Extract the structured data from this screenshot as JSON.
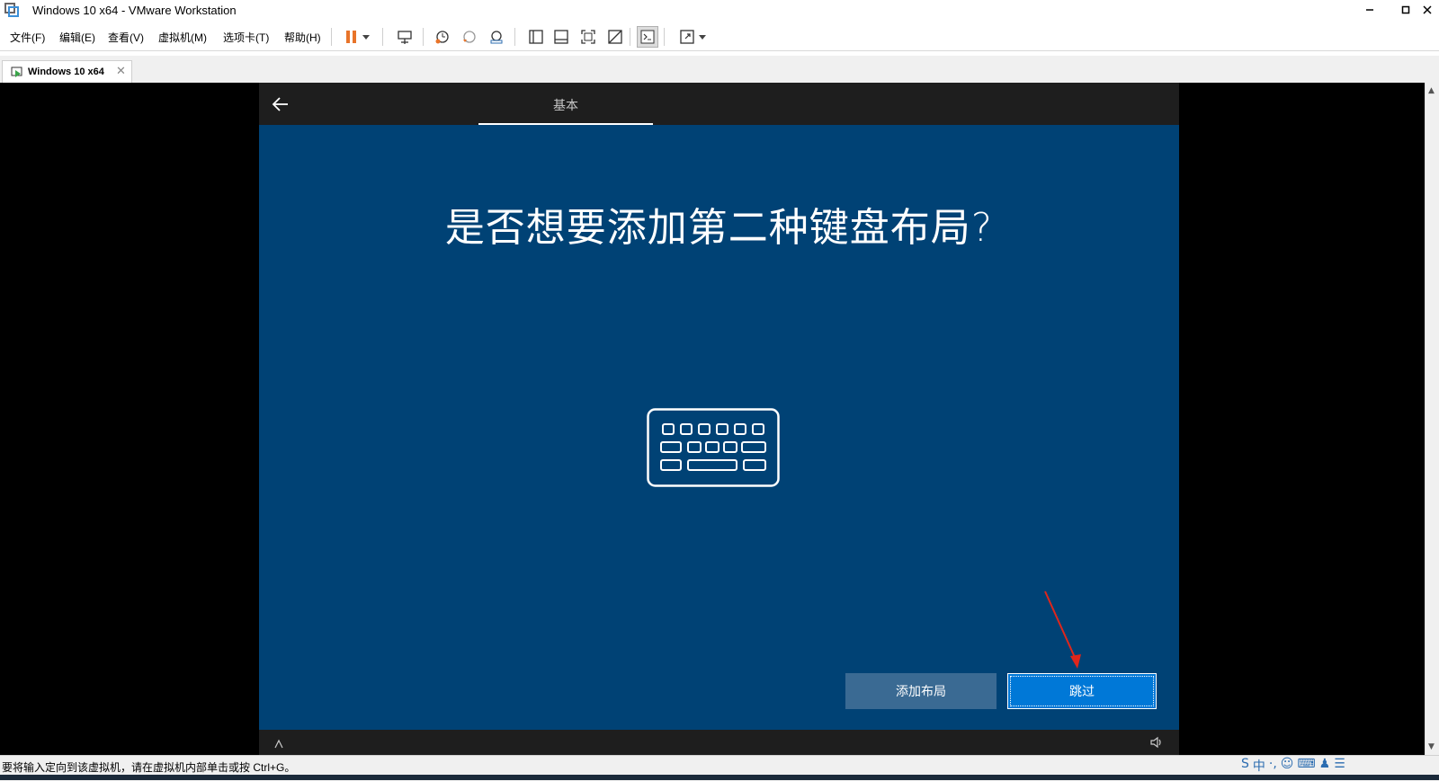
{
  "window": {
    "title": "Windows 10 x64 - VMware Workstation"
  },
  "menu": {
    "items": [
      "文件(F)",
      "编辑(E)",
      "查看(V)",
      "虚拟机(M)",
      "选项卡(T)",
      "帮助(H)"
    ]
  },
  "toolbar": {
    "icons": [
      "pause-icon",
      "dropdown-icon",
      "send-ctrl-alt-del-icon",
      "snapshot-icon",
      "revert-snapshot-icon",
      "snapshot-manager-icon",
      "show-library-icon",
      "thumbnail-bar-icon",
      "full-screen-icon",
      "unity-icon",
      "console-view-icon",
      "stretch-icon",
      "dropdown-icon"
    ]
  },
  "tabs": {
    "vm_tab_label": "Windows 10 x64"
  },
  "oobe": {
    "header_tab": "基本",
    "title": "是否想要添加第二种键盘布局?",
    "add_layout_button": "添加布局",
    "skip_button": "跳过",
    "bg_color": "#004275",
    "accent_color": "#0078d7"
  },
  "status": {
    "message": "要将输入定向到该虚拟机，请在虚拟机内部单击或按 Ctrl+G。"
  }
}
